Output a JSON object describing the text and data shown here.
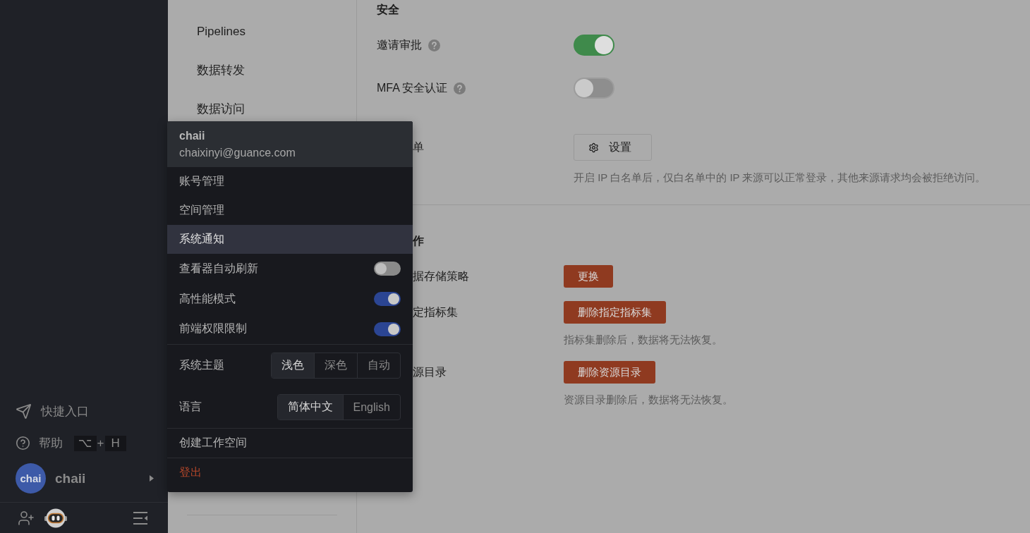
{
  "sidebar": {
    "links": [
      {
        "kind": "shortcuts",
        "label": "快捷入口"
      },
      {
        "kind": "help",
        "label": "帮助",
        "shortcut": {
          "keys": [
            "⌥",
            "H"
          ],
          "joiner": "+"
        }
      }
    ],
    "user": {
      "avatar": "chai",
      "name": "chaii"
    }
  },
  "nav": {
    "items": [
      {
        "label": "Pipelines"
      },
      {
        "label": "数据转发"
      },
      {
        "label": "数据访问"
      }
    ]
  },
  "security": {
    "title": "安全",
    "rows": [
      {
        "kind": "toggle",
        "label": "邀请审批",
        "help": true,
        "on": true
      },
      {
        "kind": "toggle",
        "label": "MFA 安全认证",
        "help": true,
        "on": false
      },
      {
        "kind": "button",
        "label": "单",
        "button": "设置",
        "description": "开启 IP 白名单后，仅白名单中的 IP 来源可以正常登录，其他来源请求均会被拒绝访问。"
      }
    ]
  },
  "danger": {
    "title": "作",
    "rows": [
      {
        "label": "据存储策略",
        "button": "更换"
      },
      {
        "label": "定指标集",
        "button": "删除指定指标集",
        "description": "指标集删除后，数据将无法恢复。"
      },
      {
        "label": "源目录",
        "button": "删除资源目录",
        "description": "资源目录删除后，数据将无法恢复。"
      }
    ]
  },
  "user_menu": {
    "name": "chaii",
    "email": "chaixinyi@guance.com",
    "items": [
      {
        "kind": "link",
        "label": "账号管理",
        "selected": false
      },
      {
        "kind": "link",
        "label": "空间管理",
        "selected": false
      },
      {
        "kind": "link",
        "label": "系统通知",
        "selected": true
      },
      {
        "kind": "toggle",
        "label": "查看器自动刷新",
        "on": false
      },
      {
        "kind": "toggle",
        "label": "高性能模式",
        "on": true
      },
      {
        "kind": "toggle",
        "label": "前端权限限制",
        "on": true
      }
    ],
    "settings": [
      {
        "label": "系统主题",
        "options": [
          {
            "label": "浅色",
            "selected": true
          },
          {
            "label": "深色",
            "selected": false
          },
          {
            "label": "自动",
            "selected": false
          }
        ]
      },
      {
        "label": "语言",
        "options": [
          {
            "label": "简体中文",
            "selected": true
          },
          {
            "label": "English",
            "selected": false
          }
        ]
      }
    ],
    "actions": [
      {
        "kind": "normal",
        "label": "创建工作空间"
      },
      {
        "kind": "danger",
        "label": "登出"
      }
    ]
  }
}
